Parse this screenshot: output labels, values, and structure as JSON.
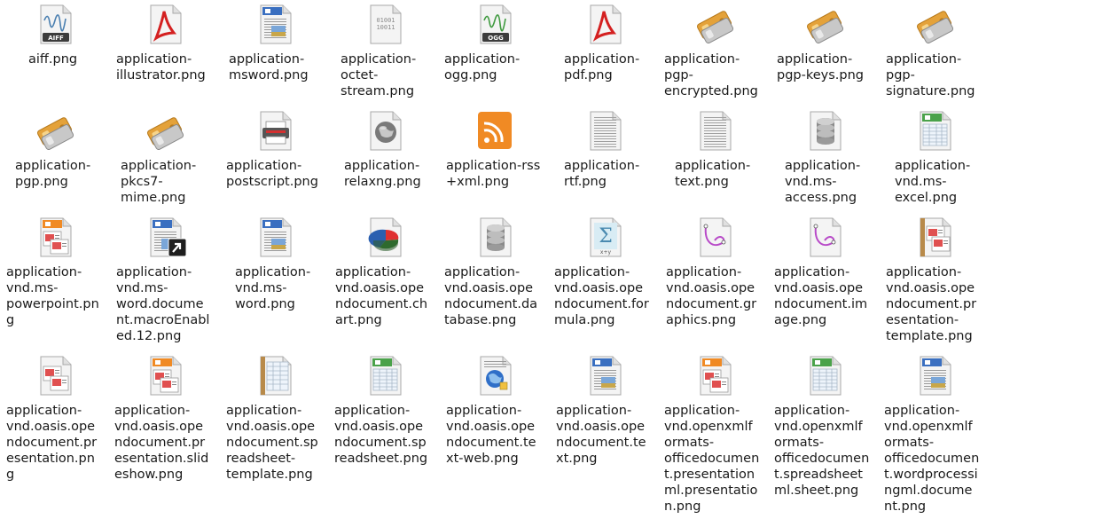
{
  "files": [
    {
      "label": "aiff.png",
      "icon": "audio-aiff-icon",
      "badge": "AIFF"
    },
    {
      "label": "application-\nillustrator.png",
      "icon": "pdf-icon"
    },
    {
      "label": "application-\nmsword.png",
      "icon": "word-document-icon"
    },
    {
      "label": "application-\noctet-\nstream.png",
      "icon": "binary-file-icon",
      "badge": "01001\n10011"
    },
    {
      "label": "application-\nogg.png",
      "icon": "audio-ogg-icon",
      "badge": "OGG"
    },
    {
      "label": "application-\npdf.png",
      "icon": "pdf-icon"
    },
    {
      "label": "application-\npgp-\nencrypted.png",
      "icon": "pgp-key-icon"
    },
    {
      "label": "application-\npgp-keys.png",
      "icon": "pgp-key-icon"
    },
    {
      "label": "application-\npgp-\nsignature.png",
      "icon": "pgp-key-icon"
    },
    {
      "label": "application-\npgp.png",
      "icon": "pgp-key-icon"
    },
    {
      "label": "application-\npkcs7-\nmime.png",
      "icon": "pgp-key-icon"
    },
    {
      "label": "application-\npostscript.png",
      "icon": "printer-document-icon"
    },
    {
      "label": "application-\nrelaxng.png",
      "icon": "globe-document-icon"
    },
    {
      "label": "application-rss\n+xml.png",
      "icon": "rss-feed-icon"
    },
    {
      "label": "application-\nrtf.png",
      "icon": "text-document-icon"
    },
    {
      "label": "application-\ntext.png",
      "icon": "text-document-icon"
    },
    {
      "label": "application-\nvnd.ms-\naccess.png",
      "icon": "database-document-icon"
    },
    {
      "label": "application-\nvnd.ms-\nexcel.png",
      "icon": "spreadsheet-icon"
    },
    {
      "label": "application-\nvnd.ms-\npowerpoint.pn\ng",
      "icon": "presentation-icon"
    },
    {
      "label": "application-\nvnd.ms-\nword.docume\nnt.macroEnabl\ned.12.png",
      "icon": "word-macro-document-icon"
    },
    {
      "label": "application-\nvnd.ms-\nword.png",
      "icon": "word-document-icon"
    },
    {
      "label": "application-\nvnd.oasis.ope\nndocument.ch\nart.png",
      "icon": "chart-document-icon"
    },
    {
      "label": "application-\nvnd.oasis.ope\nndocument.da\ntabase.png",
      "icon": "database-document-icon"
    },
    {
      "label": "application-\nvnd.oasis.ope\nndocument.for\nmula.png",
      "icon": "formula-document-icon"
    },
    {
      "label": "application-\nvnd.oasis.ope\nndocument.gr\naphics.png",
      "icon": "drawing-document-icon"
    },
    {
      "label": "application-\nvnd.oasis.ope\nndocument.im\nage.png",
      "icon": "drawing-document-icon"
    },
    {
      "label": "application-\nvnd.oasis.ope\nndocument.pr\nesentation-\ntemplate.png",
      "icon": "presentation-template-icon"
    },
    {
      "label": "application-\nvnd.oasis.ope\nndocument.pr\nesentation.pn\ng",
      "icon": "presentation-plain-icon"
    },
    {
      "label": "application-\nvnd.oasis.ope\nndocument.pr\nesentation.slid\neshow.png",
      "icon": "presentation-icon"
    },
    {
      "label": "application-\nvnd.oasis.ope\nndocument.sp\nreadsheet-\ntemplate.png",
      "icon": "spreadsheet-template-icon"
    },
    {
      "label": "application-\nvnd.oasis.ope\nndocument.sp\nreadsheet.png",
      "icon": "spreadsheet-icon"
    },
    {
      "label": "application-\nvnd.oasis.ope\nndocument.te\nxt-web.png",
      "icon": "web-document-icon"
    },
    {
      "label": "application-\nvnd.oasis.ope\nndocument.te\nxt.png",
      "icon": "word-document-icon"
    },
    {
      "label": "application-\nvnd.openxmlf\normats-\nofficedocumen\nt.presentation\nml.presentatio\nn.png",
      "icon": "presentation-icon"
    },
    {
      "label": "application-\nvnd.openxmlf\normats-\nofficedocumen\nt.spreadsheet\nml.sheet.png",
      "icon": "spreadsheet-icon"
    },
    {
      "label": "application-\nvnd.openxmlf\normats-\nofficedocumen\nt.wordprocessi\nngml.docume\nnt.png",
      "icon": "word-document-icon"
    }
  ]
}
